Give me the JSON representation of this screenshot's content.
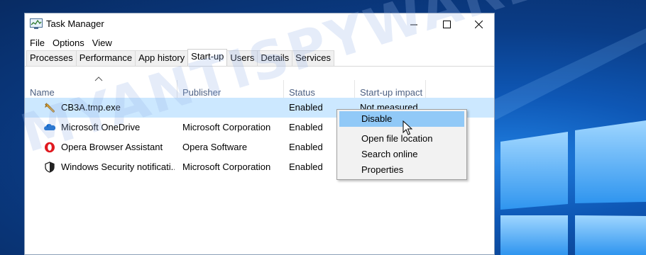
{
  "window": {
    "title": "Task Manager"
  },
  "menubar": [
    "File",
    "Options",
    "View"
  ],
  "tabs": [
    {
      "label": "Processes",
      "active": false
    },
    {
      "label": "Performance",
      "active": false
    },
    {
      "label": "App history",
      "active": false
    },
    {
      "label": "Start-up",
      "active": true
    },
    {
      "label": "Users",
      "active": false
    },
    {
      "label": "Details",
      "active": false
    },
    {
      "label": "Services",
      "active": false
    }
  ],
  "columns": {
    "name": "Name",
    "publisher": "Publisher",
    "status": "Status",
    "impact": "Start-up impact"
  },
  "rows": [
    {
      "icon": "wrench-icon",
      "name": "CB3A.tmp.exe",
      "publisher": "",
      "status": "Enabled",
      "impact": "Not measured",
      "selected": true
    },
    {
      "icon": "onedrive-cloud-icon",
      "name": "Microsoft OneDrive",
      "publisher": "Microsoft Corporation",
      "status": "Enabled",
      "impact": "",
      "selected": false
    },
    {
      "icon": "opera-icon",
      "name": "Opera Browser Assistant",
      "publisher": "Opera Software",
      "status": "Enabled",
      "impact": "",
      "selected": false
    },
    {
      "icon": "shield-icon",
      "name": "Windows Security notificati...",
      "publisher": "Microsoft Corporation",
      "status": "Enabled",
      "impact": "",
      "selected": false
    }
  ],
  "context_menu": {
    "items": [
      {
        "label": "Disable",
        "highlighted": true
      },
      {
        "label": "Open file location",
        "highlighted": false
      },
      {
        "label": "Search online",
        "highlighted": false
      },
      {
        "label": "Properties",
        "highlighted": false
      }
    ]
  },
  "watermark": "MYANTISPYWARE.COM",
  "colors": {
    "selection": "#cce8ff",
    "menu_highlight": "#91c9f7",
    "header_text": "#4d6082"
  }
}
